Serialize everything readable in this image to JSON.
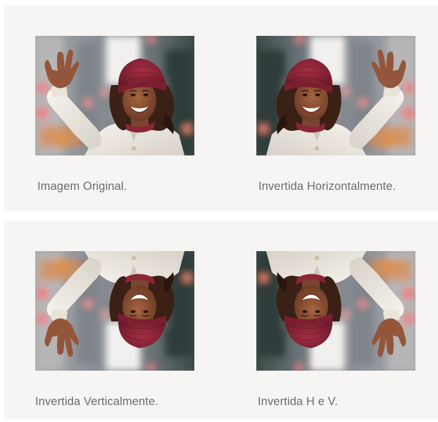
{
  "captions": {
    "original": "Imagem Original.",
    "horizontal": "Invertida Horizontalmente.",
    "vertical": "Invertida Verticalmente.",
    "both": "Invertida H e V."
  },
  "photo": {
    "subject": "woman-waving-photo",
    "hat_color": "#8f2437",
    "coat_color": "#f1ede6",
    "skin_color": "#8b5236",
    "hair_color": "#3b2016",
    "background_color": "#8d949b"
  }
}
